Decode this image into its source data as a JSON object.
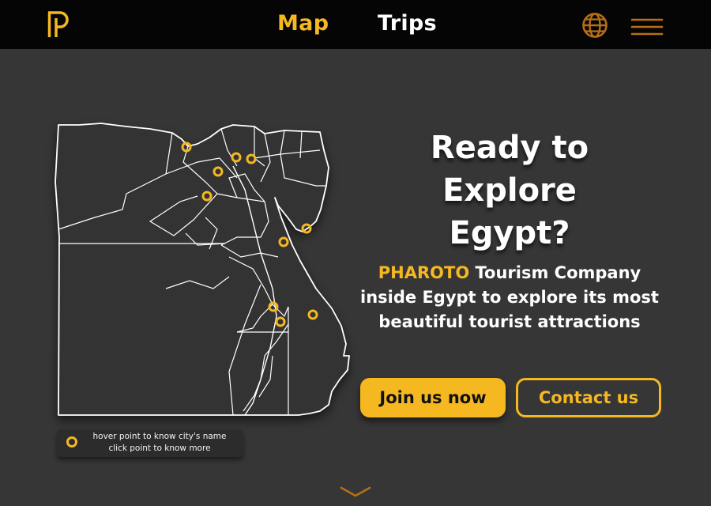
{
  "nav": {
    "links": [
      {
        "label": "Map",
        "active": true
      },
      {
        "label": "Trips",
        "active": false
      }
    ]
  },
  "icons": {
    "logo": "pharoto-logo",
    "language": "globe-icon",
    "menu": "hamburger-menu-icon",
    "scroll": "chevron-down-icon"
  },
  "colors": {
    "accent": "#f5b820",
    "background": "#363636",
    "navbar": "#050505",
    "text": "#ffffff"
  },
  "hero": {
    "headline_line1": "Ready to Explore",
    "headline_line2": "Egypt?",
    "brand": "PHAROTO",
    "desc_line1_rest": " Tourism Company",
    "desc_line2": "inside Egypt to explore its most",
    "desc_line3": "beautiful tourist attractions",
    "primary_button": "Join us now",
    "secondary_button": "Contact us"
  },
  "legend": {
    "line1": "hover point to know city's name",
    "line2": "click point to know more"
  },
  "map": {
    "city_points_count": 11
  }
}
